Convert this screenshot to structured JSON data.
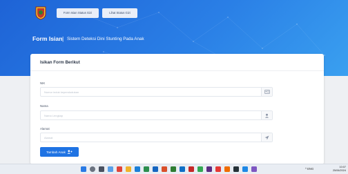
{
  "nav": {
    "buttons": [
      {
        "label": "Form Isian Status Gizi"
      },
      {
        "label": "Lihat Status Gizi"
      }
    ]
  },
  "header": {
    "title": "Form Isian",
    "separator": "|",
    "subtitle": "Sistem Deteksi Dini Stunting Pada Anak"
  },
  "card": {
    "title": "Isikan Form Berikut"
  },
  "form": {
    "fields": [
      {
        "label": "NIK",
        "placeholder": "Nomor induk kependudukan",
        "icon": "id-card-icon"
      },
      {
        "label": "Nama",
        "placeholder": "Nama Lengkap",
        "icon": "user-icon"
      },
      {
        "label": "Alamat",
        "placeholder": "Alamat",
        "icon": "location-arrow-icon"
      }
    ],
    "submit_label": "Tambah Anak"
  },
  "colors": {
    "header_gradient_start": "#1e63d6",
    "header_gradient_end": "#3aa0f0",
    "primary_button": "#1f73e3"
  },
  "taskbar": {
    "tray_text": "^ ENG",
    "time": "10:07",
    "date": "25/06/2024"
  }
}
